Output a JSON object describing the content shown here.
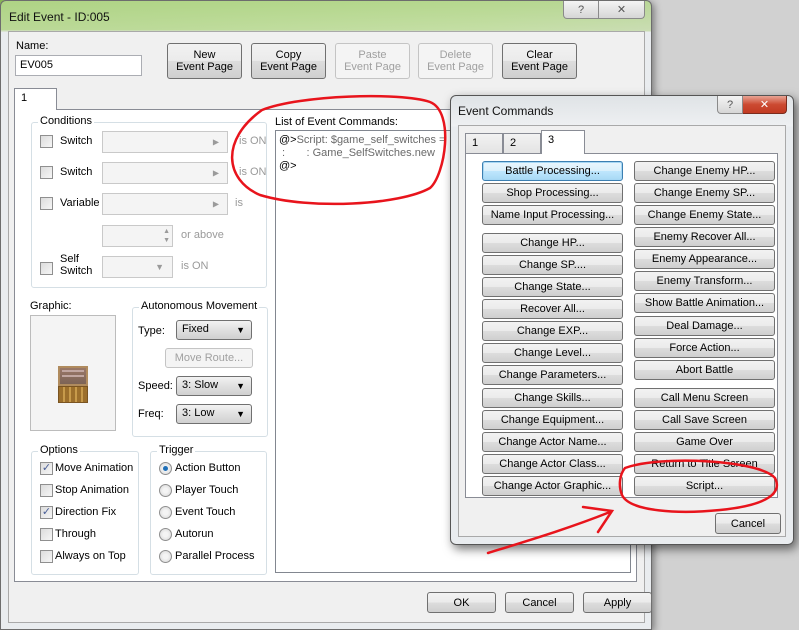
{
  "main_window": {
    "title": "Edit Event - ID:005",
    "help_icon": "?",
    "close_icon": "✕",
    "name_label": "Name:",
    "name_value": "EV005",
    "toolbar": {
      "new_page": [
        "New",
        "Event Page"
      ],
      "copy_page": [
        "Copy",
        "Event Page"
      ],
      "paste_page": [
        "Paste",
        "Event Page"
      ],
      "delete_page": [
        "Delete",
        "Event Page"
      ],
      "clear_page": [
        "Clear",
        "Event Page"
      ]
    },
    "page_tabs": [
      "1"
    ],
    "conditions": {
      "title": "Conditions",
      "switch1_label": "Switch",
      "switch1_suffix": "is ON",
      "switch2_label": "Switch",
      "switch2_suffix": "is ON",
      "variable_label": "Variable",
      "variable_suffix": "is",
      "variable_value_suffix": "or above",
      "self_switch_label_1": "Self",
      "self_switch_label_2": "Switch",
      "self_switch_suffix": "is ON"
    },
    "graphic_label": "Graphic:",
    "autonomous_movement": {
      "title": "Autonomous Movement",
      "type_label": "Type:",
      "type_value": "Fixed",
      "move_route_button": "Move Route...",
      "speed_label": "Speed:",
      "speed_value": "3: Slow",
      "freq_label": "Freq:",
      "freq_value": "3: Low"
    },
    "options": {
      "title": "Options",
      "items": [
        {
          "label": "Move Animation",
          "checked": true
        },
        {
          "label": "Stop Animation",
          "checked": false
        },
        {
          "label": "Direction Fix",
          "checked": true
        },
        {
          "label": "Through",
          "checked": false
        },
        {
          "label": "Always on Top",
          "checked": false
        }
      ]
    },
    "trigger": {
      "title": "Trigger",
      "items": [
        {
          "label": "Action Button",
          "selected": true
        },
        {
          "label": "Player Touch",
          "selected": false
        },
        {
          "label": "Event Touch",
          "selected": false
        },
        {
          "label": "Autorun",
          "selected": false
        },
        {
          "label": "Parallel Process",
          "selected": false
        }
      ]
    },
    "event_commands_list": {
      "label": "List of Event Commands:",
      "lines": [
        "@>Script: $game_self_switches =",
        " :       : Game_SelfSwitches.new",
        "@>"
      ]
    },
    "footer": {
      "ok": "OK",
      "cancel": "Cancel",
      "apply": "Apply"
    }
  },
  "event_commands_dialog": {
    "title": "Event Commands",
    "help_icon": "?",
    "close_icon": "✕",
    "tabs": [
      "1",
      "2",
      "3"
    ],
    "active_tab": "3",
    "left_column": [
      "Battle Processing...",
      "Shop Processing...",
      "Name Input Processing...",
      "Change HP...",
      "Change SP....",
      "Change State...",
      "Recover All...",
      "Change EXP...",
      "Change Level...",
      "Change Parameters...",
      "Change Skills...",
      "Change Equipment...",
      "Change Actor Name...",
      "Change Actor Class...",
      "Change Actor Graphic..."
    ],
    "right_column": [
      "Change Enemy HP...",
      "Change Enemy SP...",
      "Change Enemy State...",
      "Enemy Recover All...",
      "Enemy Appearance...",
      "Enemy Transform...",
      "Show Battle Animation...",
      "Deal Damage...",
      "Force Action...",
      "Abort Battle",
      "Call Menu Screen",
      "Call Save Screen",
      "Game Over",
      "Return to Title Screen",
      "Script..."
    ],
    "cancel": "Cancel"
  },
  "annotations": {
    "color": "#e8141c",
    "circled": [
      "List of Event Commands",
      "Script..."
    ],
    "arrow_points_to": "Script..."
  }
}
